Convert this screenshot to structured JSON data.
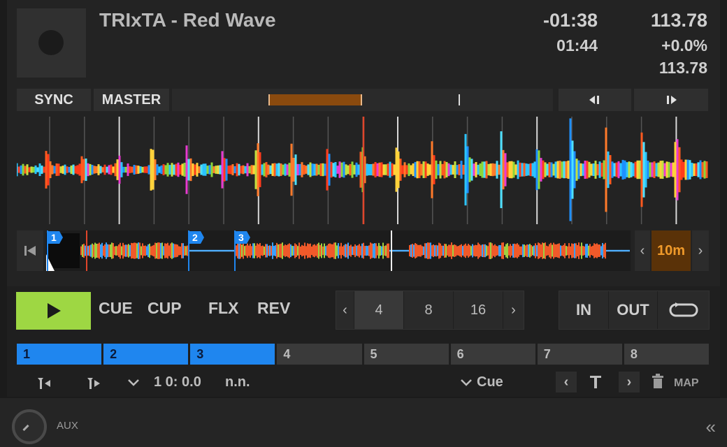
{
  "track": {
    "title": "TRIxTA - Red Wave",
    "time_remaining": "-01:38",
    "time_elapsed": "01:44",
    "bpm": "113.78",
    "tempo_offset": "+0.0%",
    "bpm_original": "113.78"
  },
  "sync_row": {
    "sync_label": "SYNC",
    "master_label": "MASTER",
    "nudge_back_icon": "nudge-back-icon",
    "nudge_forward_icon": "nudge-forward-icon"
  },
  "overview": {
    "cue_markers": [
      "1",
      "2",
      "3"
    ],
    "zoom_label": "10m"
  },
  "transport": {
    "cue_label": "CUE",
    "cup_label": "CUP",
    "flx_label": "FLX",
    "rev_label": "REV",
    "loop_sizes": [
      "4",
      "8",
      "16"
    ],
    "selected_loop_size": "4",
    "in_label": "IN",
    "out_label": "OUT"
  },
  "hotcues": [
    {
      "label": "1",
      "active": true
    },
    {
      "label": "2",
      "active": true
    },
    {
      "label": "3",
      "active": true
    },
    {
      "label": "4",
      "active": false
    },
    {
      "label": "5",
      "active": false
    },
    {
      "label": "6",
      "active": false
    },
    {
      "label": "7",
      "active": false
    },
    {
      "label": "8",
      "active": false
    }
  ],
  "cue_info": {
    "position": "1 0: 0.0",
    "name": "n.n.",
    "type": "Cue",
    "map_label": "MAP"
  },
  "aux": {
    "label": "AUX"
  },
  "colors": {
    "play_green": "#9ed743",
    "hotcue_blue": "#1f86ef",
    "zoom_orange": "#f09a2a",
    "playhead_red": "#e0452b"
  }
}
